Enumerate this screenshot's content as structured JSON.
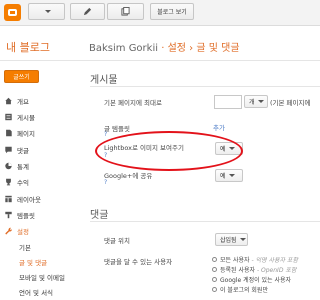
{
  "topbar": {
    "blog_button": "블로그 보기"
  },
  "header": {
    "title": "내 블로그",
    "blog_name": "Baksim Gorkii",
    "sep1": "·",
    "setting": "설정",
    "sep2": "›",
    "page": "글 및 댓글"
  },
  "sidebar": {
    "new_post": "글쓰기",
    "items": [
      "개요",
      "게시물",
      "페이지",
      "댓글",
      "통계",
      "수익",
      "레이아웃",
      "템플릿",
      "설정"
    ],
    "subitems": [
      "기본",
      "글 및 댓글",
      "모바일 및 이메일",
      "언어 및 서식"
    ]
  },
  "posts": {
    "section": "게시물",
    "max_label": "기본 페이지에 최대로",
    "max_value": "",
    "max_unit": "개",
    "max_suffix": "(기본 페이지에",
    "template_label": "글 템플릿",
    "qmark": "?",
    "add": "추가",
    "lightbox_label": "Lightbox로 이미지 보여주기",
    "lightbox_value": "예",
    "google_label": "Google+에 공유",
    "google_value": "예"
  },
  "comments": {
    "section": "댓글",
    "position_label": "댓글 위치",
    "position_value": "삽입됨",
    "who_label": "댓글을 달 수 있는 사용자",
    "options": [
      {
        "label": "모든 사용자",
        "note": "- 익명 사용자 포함"
      },
      {
        "label": "등록된 사용자",
        "note": "- OpenID 포함"
      },
      {
        "label": "Google 계정이 있는 사용자",
        "note": ""
      },
      {
        "label": "이 블로그의 회원만",
        "note": ""
      }
    ]
  }
}
